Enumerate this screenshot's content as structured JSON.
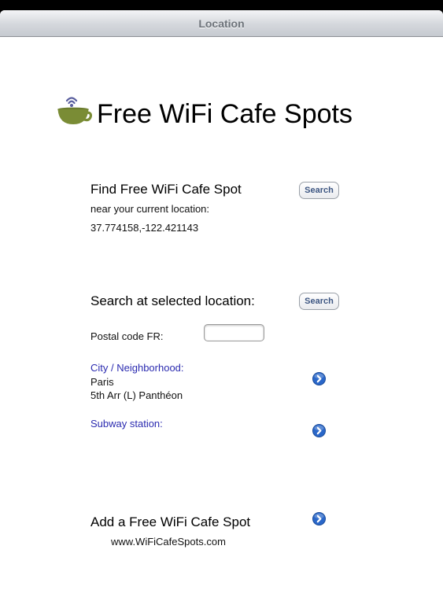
{
  "navbar": {
    "title": "Location"
  },
  "app": {
    "title": "Free WiFi Cafe Spots",
    "logo_icon": "wifi-cup-icon"
  },
  "current_location": {
    "heading": "Find Free WiFi Cafe Spot",
    "subtext": "near your current location:",
    "coordinates": "37.774158,-122.421143",
    "search_label": "Search"
  },
  "selected_location": {
    "heading": "Search at selected location:",
    "search_label": "Search",
    "postal_label": "Postal code FR:",
    "postal_value": "",
    "city_label": "City / Neighborhood:",
    "city_value": "Paris",
    "neighborhood_value": "5th Arr (L) Panthéon",
    "subway_label": "Subway station:"
  },
  "add_spot": {
    "heading": "Add a Free WiFi Cafe Spot",
    "website": "www.WiFiCafeSpots.com"
  },
  "colors": {
    "cup": "#7a8c35",
    "wifi": "#5a5f9e",
    "link_label": "#2b2bb0",
    "disclosure": "#2a67c9"
  }
}
